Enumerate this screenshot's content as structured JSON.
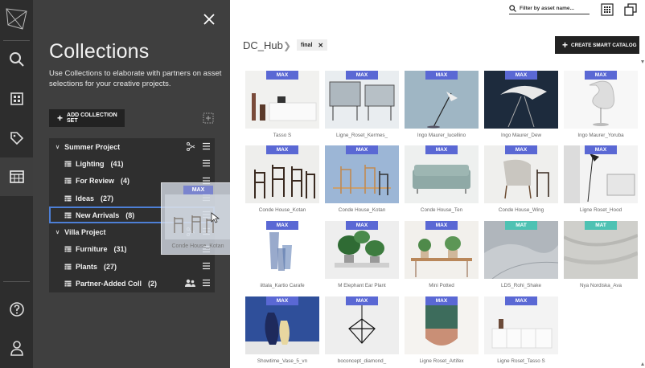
{
  "rail": {
    "items": [
      "search-icon",
      "dashboard-icon",
      "tag-icon",
      "collections-icon"
    ],
    "bottom": [
      "help-icon",
      "user-icon"
    ]
  },
  "panel": {
    "title": "Collections",
    "description": "Use Collections to elaborate with partners on asset selections for your creative projects.",
    "add_button": "ADD COLLECTION SET",
    "tree": [
      {
        "type": "group",
        "label": "Summer Project",
        "count": ""
      },
      {
        "type": "child",
        "label": "Lighting",
        "count": "(41)"
      },
      {
        "type": "child",
        "label": "For Review",
        "count": "(4)"
      },
      {
        "type": "child",
        "label": "Ideas",
        "count": "(27)"
      },
      {
        "type": "child",
        "label": "New Arrivals",
        "count": "(8)",
        "selected": true
      },
      {
        "type": "group",
        "label": "Villa Project",
        "count": ""
      },
      {
        "type": "child",
        "label": "Furniture",
        "count": "(31)"
      },
      {
        "type": "child",
        "label": "Plants",
        "count": "(27)"
      },
      {
        "type": "child",
        "label": "Partner-Added Coll",
        "count": "(2)"
      }
    ]
  },
  "ghost": {
    "badge": "MAX",
    "caption": "Conde House_Kotan"
  },
  "main": {
    "search_placeholder": "Filter by asset name...",
    "breadcrumb": "DC_Hub",
    "chip": "final",
    "create_button": "CREATE SMART CATALOG",
    "colors": {
      "max": "#5a68d4",
      "mat": "#4ec2b3"
    },
    "assets": [
      {
        "badge": "MAX",
        "caption": "Tasso S",
        "scene": "sideboard"
      },
      {
        "badge": "MAX",
        "caption": "Ligne_Roset_Kermes_",
        "scene": "shelves"
      },
      {
        "badge": "MAX",
        "caption": "Ingo Maurer_lucellino",
        "scene": "lamp-blue"
      },
      {
        "badge": "MAX",
        "caption": "Ingo Maurer_Dew",
        "scene": "lamp-dark"
      },
      {
        "badge": "MAX",
        "caption": "Ingo Maurer_Yoruba",
        "scene": "lamp-white"
      },
      {
        "badge": "MAX",
        "caption": "Conde House_Kotan",
        "scene": "chairs"
      },
      {
        "badge": "MAX",
        "caption": "Conde House_Kotan",
        "scene": "chairs-blue"
      },
      {
        "badge": "MAX",
        "caption": "Conde House_Ten",
        "scene": "sofa"
      },
      {
        "badge": "MAX",
        "caption": "Conde House_Wing",
        "scene": "armchair"
      },
      {
        "badge": "MAX",
        "caption": "Ligne Roset_Hood",
        "scene": "floorlamp"
      },
      {
        "badge": "MAX",
        "caption": "iittala_Kartio Carafe",
        "scene": "glass"
      },
      {
        "badge": "MAX",
        "caption": "M Elephant Ear Plant",
        "scene": "plants"
      },
      {
        "badge": "MAX",
        "caption": "Mini Potted",
        "scene": "potted"
      },
      {
        "badge": "MAT",
        "caption": "LDS_Rohi_Shake",
        "scene": "fabric"
      },
      {
        "badge": "MAT",
        "caption": "Nya Nordiska_Ava",
        "scene": "fabric-grey"
      },
      {
        "badge": "MAX",
        "caption": "Showtime_Vase_5_vn",
        "scene": "vases"
      },
      {
        "badge": "MAX",
        "caption": "boconcept_diamond_",
        "scene": "diamond"
      },
      {
        "badge": "MAX",
        "caption": "Ligne Roset_Artifex",
        "scene": "artifex"
      },
      {
        "badge": "MAX",
        "caption": "Ligne Roset_Tasso S",
        "scene": "tasso"
      }
    ]
  }
}
